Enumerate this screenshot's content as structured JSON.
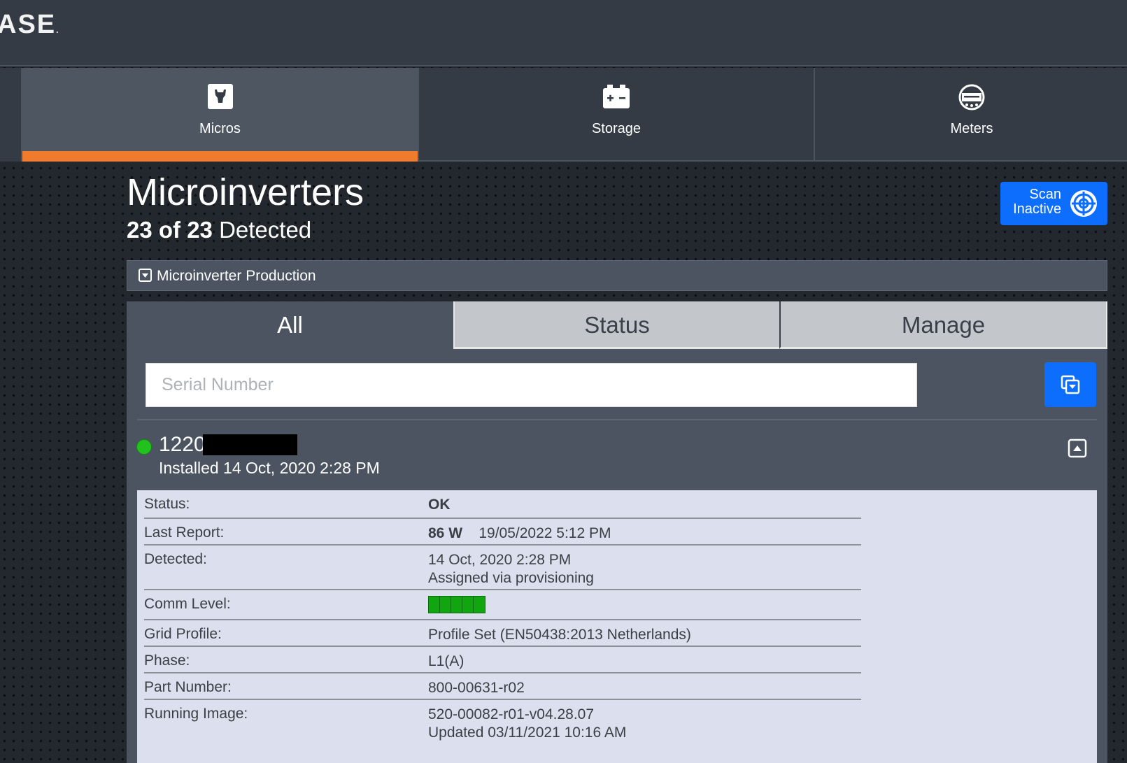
{
  "brand": {
    "logo_text": "ASE",
    "logo_dot": "."
  },
  "nav": {
    "tabs": [
      {
        "label": "Micros",
        "icon": "micro-icon",
        "active": true
      },
      {
        "label": "Storage",
        "icon": "battery-icon",
        "active": false
      },
      {
        "label": "Meters",
        "icon": "meter-icon",
        "active": false
      }
    ]
  },
  "page": {
    "title": "Microinverters",
    "detected_count": "23 of 23",
    "detected_suffix": " Detected"
  },
  "scan_button": {
    "line1": "Scan",
    "line2": "Inactive",
    "icon": "target-icon"
  },
  "production_bar": {
    "label": "Microinverter Production",
    "icon": "dropdown-box-icon"
  },
  "subtabs": [
    {
      "label": "All",
      "active": true
    },
    {
      "label": "Status",
      "active": false
    },
    {
      "label": "Manage",
      "active": false
    }
  ],
  "search": {
    "placeholder": "Serial Number",
    "value": ""
  },
  "device": {
    "serial_visible": "1220",
    "installed": "Installed 14 Oct, 2020 2:28 PM",
    "status_color": "#23c11d",
    "details": {
      "status_label": "Status:",
      "status_value": "OK",
      "last_report_label": "Last Report:",
      "last_report_power": "86 W",
      "last_report_time": "19/05/2022 5:12 PM",
      "detected_label": "Detected:",
      "detected_time": "14 Oct, 2020 2:28 PM",
      "detected_note": "Assigned via provisioning",
      "comm_label": "Comm Level:",
      "comm_level": 5,
      "comm_max": 5,
      "grid_label": "Grid Profile:",
      "grid_value": "Profile Set (EN50438:2013 Netherlands)",
      "phase_label": "Phase:",
      "phase_value": "L1(A)",
      "part_label": "Part Number:",
      "part_value": "800-00631-r02",
      "image_label": "Running Image:",
      "image_value": "520-00082-r01-v04.28.07",
      "image_updated": "Updated 03/11/2021 10:16 AM"
    }
  },
  "colors": {
    "accent_orange": "#f07b2c",
    "button_blue": "#0d6efd",
    "ok_green": "#23c11d"
  }
}
